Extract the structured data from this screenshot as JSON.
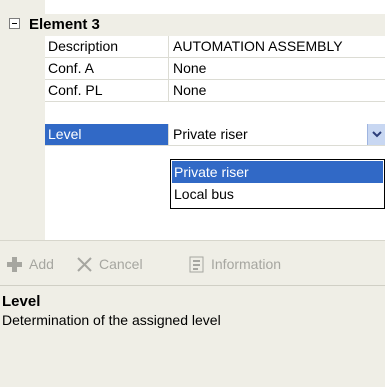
{
  "section": {
    "title": "Element 3"
  },
  "properties": [
    {
      "name": "Description",
      "value": "AUTOMATION ASSEMBLY"
    },
    {
      "name": "Conf. A",
      "value": "None"
    },
    {
      "name": "Conf. PL",
      "value": "None"
    },
    {
      "name": "Level",
      "value": "Private riser"
    }
  ],
  "dropdown": {
    "options": [
      "Private riser",
      "Local bus"
    ],
    "selected": "Private riser"
  },
  "toolbar": {
    "add_label": "Add",
    "cancel_label": "Cancel",
    "info_label": "Information"
  },
  "help": {
    "title": "Level",
    "text": "Determination of the assigned level"
  },
  "colors": {
    "selection": "#3169c6",
    "panel": "#efeee6",
    "add_icon": "#a6a6a0"
  },
  "icons": {
    "expander": "collapse-icon",
    "combo": "chevron-down-icon",
    "add": "plus-icon",
    "cancel": "x-icon",
    "info": "info-icon"
  }
}
